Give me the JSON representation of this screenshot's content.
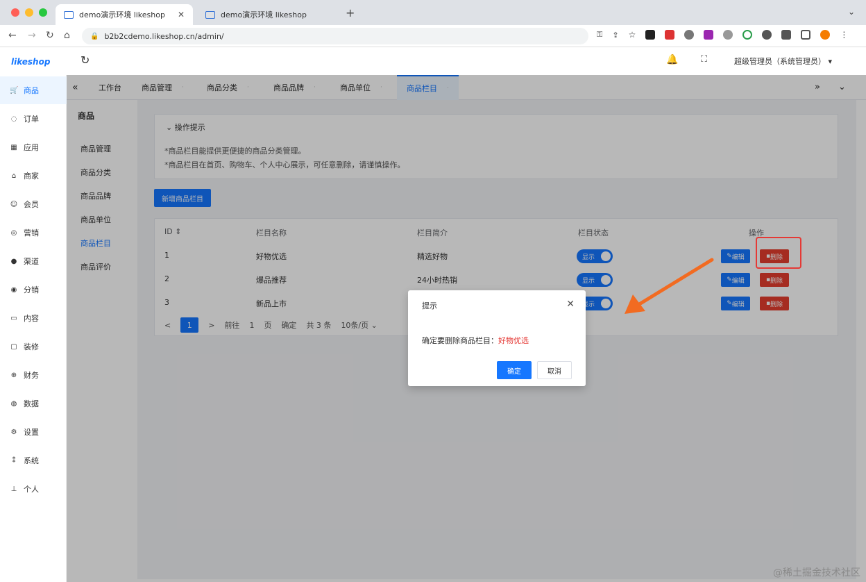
{
  "browser": {
    "tabs": [
      {
        "label": "demo演示环境 likeshop"
      },
      {
        "label": "demo演示环境 likeshop"
      }
    ],
    "url": "b2b2cdemo.likeshop.cn/admin/",
    "colors": {
      "close": "#ff5f57",
      "min": "#febc2e",
      "max": "#28c840"
    }
  },
  "header": {
    "logo": "likeshop",
    "user": "超级管理员（系统管理员）"
  },
  "sidebar": {
    "items": [
      {
        "label": "商品",
        "icon": "cart-icon"
      },
      {
        "label": "订单",
        "icon": "bell-icon"
      },
      {
        "label": "应用",
        "icon": "grid-icon"
      },
      {
        "label": "商家",
        "icon": "store-icon"
      },
      {
        "label": "会员",
        "icon": "user-icon"
      },
      {
        "label": "营销",
        "icon": "gift-icon"
      },
      {
        "label": "渠道",
        "icon": "circle-icon"
      },
      {
        "label": "分销",
        "icon": "share-icon"
      },
      {
        "label": "内容",
        "icon": "book-icon"
      },
      {
        "label": "装修",
        "icon": "palette-icon"
      },
      {
        "label": "财务",
        "icon": "money-icon"
      },
      {
        "label": "数据",
        "icon": "chart-icon"
      },
      {
        "label": "设置",
        "icon": "gear-icon"
      },
      {
        "label": "系统",
        "icon": "system-icon"
      },
      {
        "label": "个人",
        "icon": "person-icon"
      }
    ]
  },
  "pagetabs": [
    "工作台",
    "商品管理",
    "商品分类",
    "商品品牌",
    "商品单位",
    "商品栏目"
  ],
  "submenu": {
    "title": "商品",
    "items": [
      "商品管理",
      "商品分类",
      "商品品牌",
      "商品单位",
      "商品栏目",
      "商品评价"
    ]
  },
  "tips": {
    "title": "操作提示",
    "lines": [
      "*商品栏目能提供更便捷的商品分类管理。",
      "*商品栏目在首页、购物车、个人中心展示，可任意删除，请谨慎操作。"
    ]
  },
  "add_button": "新增商品栏目",
  "table": {
    "headers": [
      "ID",
      "栏目名称",
      "栏目简介",
      "栏目状态",
      "操作"
    ],
    "rows": [
      {
        "id": "1",
        "name": "好物优选",
        "desc": "精选好物",
        "status": "显示"
      },
      {
        "id": "2",
        "name": "爆品推荐",
        "desc": "24小时热销",
        "status": "显示"
      },
      {
        "id": "3",
        "name": "新品上市",
        "desc": "",
        "status": "显示"
      }
    ],
    "edit_label": "编辑",
    "delete_label": "删除"
  },
  "pager": {
    "prev": "<",
    "page": "1",
    "next": ">",
    "goto_label": "前往",
    "goto_value": "1",
    "unit": "页",
    "confirm": "确定",
    "total": "共 3 条",
    "size": "10条/页"
  },
  "dialog": {
    "title": "提示",
    "message": "确定要删除商品栏目：",
    "target": "好物优选",
    "ok": "确定",
    "cancel": "取消"
  },
  "watermark": "@稀土掘金技术社区"
}
